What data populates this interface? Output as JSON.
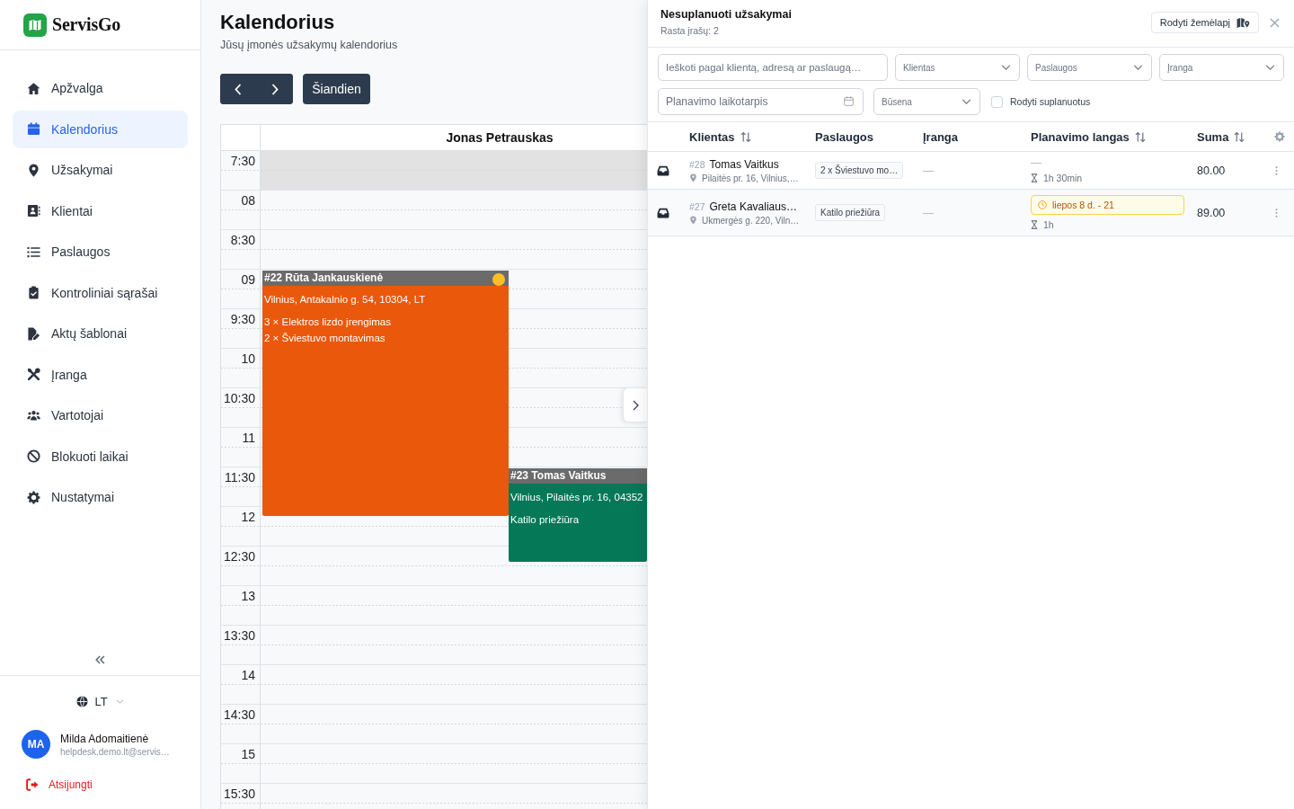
{
  "sidebar": {
    "logo": "ServisGo",
    "items": [
      {
        "label": "Apžvalga",
        "selected": false
      },
      {
        "label": "Kalendorius",
        "selected": true
      },
      {
        "label": "Užsakymai",
        "selected": false
      },
      {
        "label": "Klientai",
        "selected": false
      },
      {
        "label": "Paslaugos",
        "selected": false
      },
      {
        "label": "Kontroliniai sąrašai",
        "selected": false
      },
      {
        "label": "Aktų šablonai",
        "selected": false
      },
      {
        "label": "Įranga",
        "selected": false
      },
      {
        "label": "Vartotojai",
        "selected": false
      },
      {
        "label": "Blokuoti laikai",
        "selected": false
      },
      {
        "label": "Nustatymai",
        "selected": false
      }
    ],
    "language": "LT",
    "user": {
      "initials": "MA",
      "name": "Milda Adomaitienė",
      "email": "helpdesk.demo.lt@servis…"
    },
    "logout": "Atsijungti"
  },
  "page": {
    "title": "Kalendorius",
    "subtitle": "Jūsų įmonės užsakymų kalendorius",
    "today_button": "Šiandien"
  },
  "calendar": {
    "resource": "Jonas Petrauskas",
    "slots": [
      {
        "label": "7:30",
        "off_hours": true
      },
      {
        "label": "08",
        "off_hours": false
      },
      {
        "label": "8:30",
        "off_hours": false
      },
      {
        "label": "09",
        "off_hours": false
      },
      {
        "label": "9:30",
        "off_hours": false
      },
      {
        "label": "10",
        "off_hours": false
      },
      {
        "label": "10:30",
        "off_hours": false
      },
      {
        "label": "11",
        "off_hours": false
      },
      {
        "label": "11:30",
        "off_hours": false
      },
      {
        "label": "12",
        "off_hours": false
      },
      {
        "label": "12:30",
        "off_hours": false
      },
      {
        "label": "13",
        "off_hours": false
      },
      {
        "label": "13:30",
        "off_hours": false
      },
      {
        "label": "14",
        "off_hours": false
      },
      {
        "label": "14:30",
        "off_hours": false
      },
      {
        "label": "15",
        "off_hours": false
      },
      {
        "label": "15:30",
        "off_hours": false
      }
    ],
    "events": [
      {
        "title": "#22 Rūta Jankauskienė",
        "color": "#ea580c",
        "status_dot": {
          "color": "#fbbf24"
        },
        "address": "Vilnius, Antakalnio g. 54, 10304, LT",
        "services": [
          "3 × Elektros lizdo įrengimas",
          "2 × Šviestuvo montavimas"
        ]
      },
      {
        "title": "#23 Tomas Vaitkus",
        "color": "#047857",
        "address": "Vilnius, Pilaitės pr. 16, 04352",
        "services": [
          "Katilo priežiūra"
        ]
      }
    ]
  },
  "panel": {
    "title": "Nesuplanuoti užsakymai",
    "count": "Rasta įrašų: 2",
    "map_button": "Rodyti žemėlapį",
    "filters": {
      "search": {
        "placeholder": "Ieškoti pagal klientą, adresą ar paslaugą…"
      },
      "selects": [
        {
          "placeholder": "Klientas"
        },
        {
          "placeholder": "Paslaugos"
        },
        {
          "placeholder": "Įranga"
        }
      ],
      "period": {
        "placeholder": "Planavimo laikotarpis"
      },
      "status": {
        "placeholder": "Būsena"
      },
      "show_scheduled": {
        "label": "Rodyti suplanuotus",
        "checked": false
      }
    },
    "columns": [
      {
        "label": "Klientas",
        "sortable": true
      },
      {
        "label": "Paslaugos",
        "sortable": false
      },
      {
        "label": "Įranga",
        "sortable": false
      },
      {
        "label": "Planavimo langas",
        "sortable": true
      },
      {
        "label": "Suma",
        "sortable": true
      }
    ],
    "rows": [
      {
        "number": "#28",
        "client": "Tomas Vaitkus",
        "address": "Pilaitės pr. 16, Vilnius,…",
        "service": "2 x Šviestuvo mo…",
        "equipment": "—",
        "window": {
          "kind": "empty",
          "text": "—"
        },
        "duration": "1h 30min",
        "amount": "80.00"
      },
      {
        "number": "#27",
        "client": "Greta Kavaliaus…",
        "address": "Ukmergės g. 220, Viln…",
        "service": "Katilo priežiūra",
        "equipment": "—",
        "window": {
          "kind": "badge",
          "text": "liepos 8 d. - 21"
        },
        "duration": "1h",
        "amount": "89.00"
      }
    ]
  }
}
